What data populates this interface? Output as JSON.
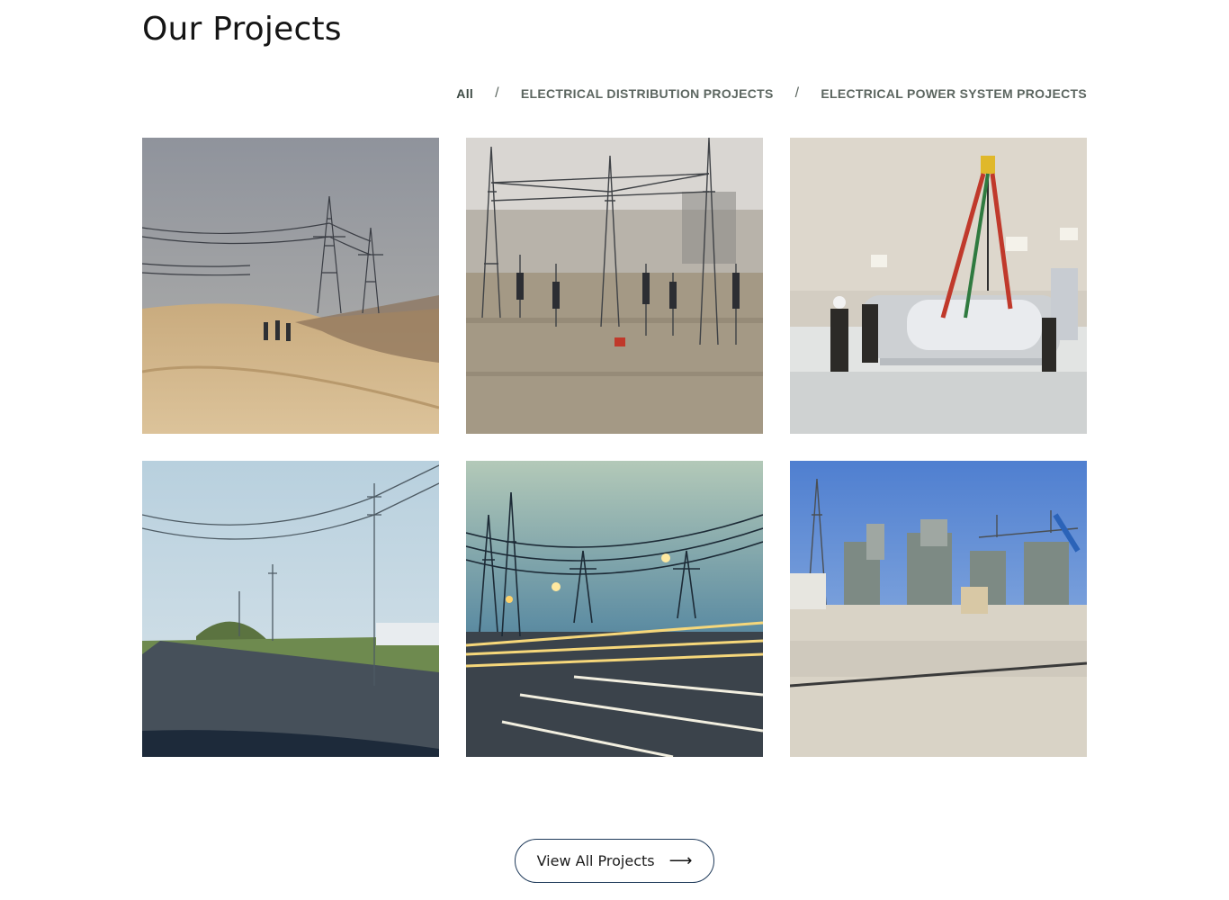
{
  "section": {
    "title": "Our Projects"
  },
  "filters": {
    "items": [
      {
        "label": "All",
        "active": true
      },
      {
        "label": "ELECTRICAL DISTRIBUTION PROJECTS",
        "active": false
      },
      {
        "label": "ELECTRICAL POWER SYSTEM PROJECTS",
        "active": false
      }
    ],
    "separator": "/"
  },
  "projects": [
    {
      "image": "desert-transmission-towers"
    },
    {
      "image": "substation-switchyard"
    },
    {
      "image": "indoor-gis-installation"
    },
    {
      "image": "roadside-distribution-lines"
    },
    {
      "image": "highway-light-trails-towers"
    },
    {
      "image": "outdoor-substation-transformers"
    }
  ],
  "cta": {
    "label": "View All Projects",
    "icon": "arrow-right-icon"
  },
  "colors": {
    "button_border": "#1f3a5a",
    "filter_text": "#5c6660"
  }
}
